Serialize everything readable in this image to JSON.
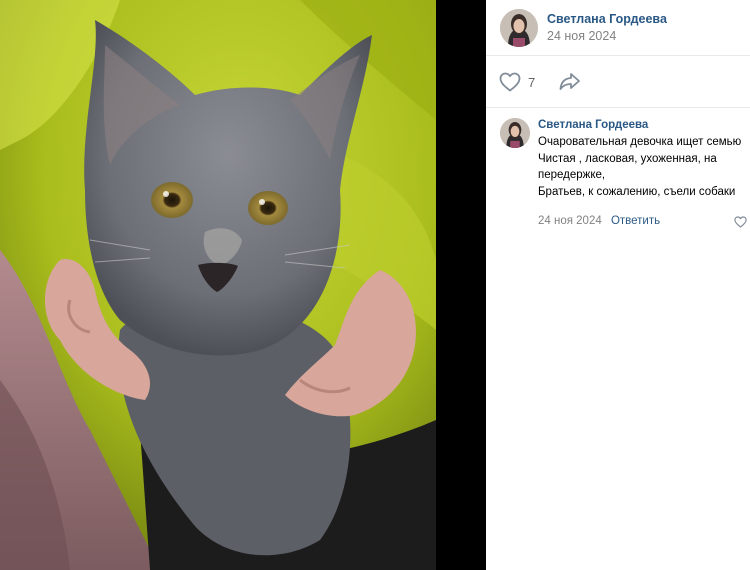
{
  "post": {
    "author": "Светлана Гордеева",
    "date": "24 ноя 2024",
    "likes": "7"
  },
  "icons": {
    "like": "heart-outline-icon",
    "share": "share-arrow-icon",
    "comment_like": "heart-outline-icon"
  },
  "comment": {
    "author": "Светлана Гордеева",
    "lines": [
      "Очаровательная девочка ищет семью",
      "Чистая , ласковая, ухоженная, на передержке,",
      "Братьев, к сожалению, съели собаки"
    ],
    "date": "24 ноя 2024",
    "reply_label": "Ответить"
  },
  "colors": {
    "link": "#2a5885",
    "muted": "#828282",
    "background_viewer": "#000000"
  }
}
